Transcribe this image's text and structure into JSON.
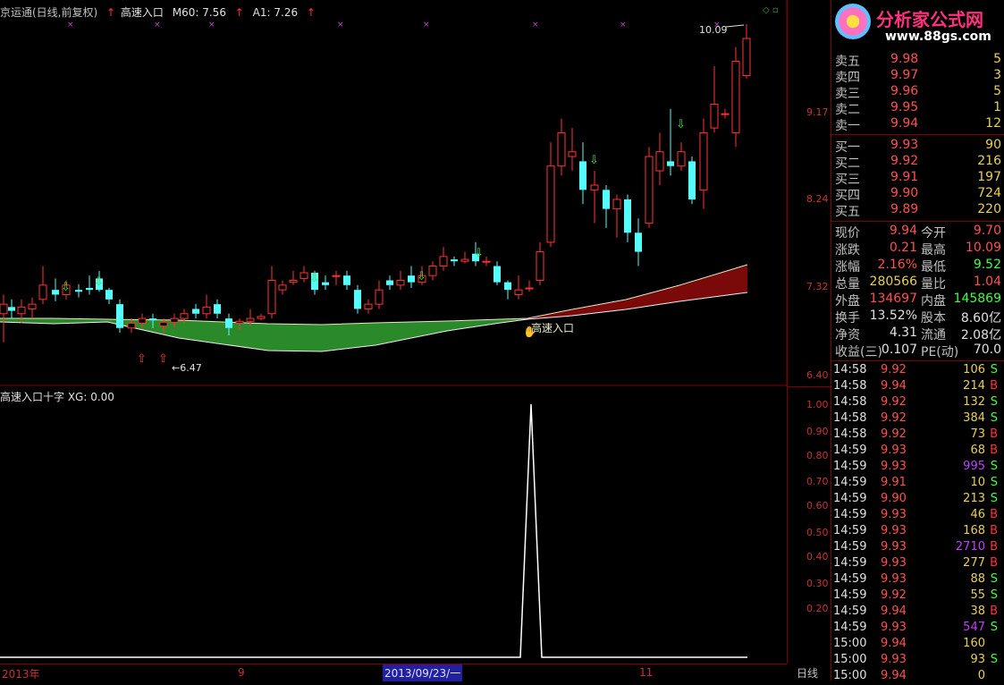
{
  "header": {
    "title": "京运通(日线,前复权)",
    "indicator": "高速入口",
    "m60_label": "M60: 7.56",
    "a1_label": "A1: 7.26"
  },
  "price_axis": [
    "9.17",
    "8.24",
    "7.32",
    "6.40"
  ],
  "price_high_note": "10.09",
  "price_low_note": "6.47",
  "signal_label": "高速入口",
  "sub_header": "高速入口十字  XG: 0.00",
  "sub_axis": [
    "1.00",
    "0.90",
    "0.80",
    "0.70",
    "0.60",
    "0.50",
    "0.40",
    "0.30",
    "0.20"
  ],
  "date_bar": {
    "start": "2013年",
    "m9": "9",
    "cursor": "2013/09/23/一",
    "m11": "11",
    "period": "日线"
  },
  "logo": {
    "brand": "分析家公式网",
    "url": "www.88gs.com"
  },
  "order_book": {
    "sells": [
      {
        "label": "卖五",
        "price": "9.98",
        "vol": "5"
      },
      {
        "label": "卖四",
        "price": "9.97",
        "vol": "3"
      },
      {
        "label": "卖三",
        "price": "9.96",
        "vol": "5"
      },
      {
        "label": "卖二",
        "price": "9.95",
        "vol": "1"
      },
      {
        "label": "卖一",
        "price": "9.94",
        "vol": "12"
      }
    ],
    "buys": [
      {
        "label": "买一",
        "price": "9.93",
        "vol": "90"
      },
      {
        "label": "买二",
        "price": "9.92",
        "vol": "216"
      },
      {
        "label": "买三",
        "price": "9.91",
        "vol": "197"
      },
      {
        "label": "买四",
        "price": "9.90",
        "vol": "724"
      },
      {
        "label": "买五",
        "price": "9.89",
        "vol": "220"
      }
    ]
  },
  "stats": [
    {
      "l1": "现价",
      "v1": "9.94",
      "l2": "今开",
      "v2": "9.70"
    },
    {
      "l1": "涨跌",
      "v1": "0.21",
      "l2": "最高",
      "v2": "10.09"
    },
    {
      "l1": "涨幅",
      "v1": "2.16%",
      "l2": "最低",
      "v2": "9.52"
    },
    {
      "l1": "总量",
      "v1": "280566",
      "l2": "量比",
      "v2": "1.04"
    },
    {
      "l1": "外盘",
      "v1": "134697",
      "l2": "内盘",
      "v2": "145869"
    },
    {
      "l1": "换手",
      "v1": "13.52%",
      "l2": "股本",
      "v2": "8.60亿"
    },
    {
      "l1": "净资",
      "v1": "4.31",
      "l2": "流通",
      "v2": "2.08亿"
    },
    {
      "l1": "收益(三)",
      "v1": "0.107",
      "l2": "PE(动)",
      "v2": "70.0"
    }
  ],
  "ticks": [
    {
      "t": "14:58",
      "p": "9.92",
      "v": "106",
      "s": "S"
    },
    {
      "t": "14:58",
      "p": "9.94",
      "v": "214",
      "s": "B"
    },
    {
      "t": "14:58",
      "p": "9.92",
      "v": "132",
      "s": "S"
    },
    {
      "t": "14:58",
      "p": "9.92",
      "v": "384",
      "s": "S"
    },
    {
      "t": "14:58",
      "p": "9.92",
      "v": "73",
      "s": "B"
    },
    {
      "t": "14:59",
      "p": "9.93",
      "v": "68",
      "s": "B"
    },
    {
      "t": "14:59",
      "p": "9.93",
      "v": "995",
      "s": "S"
    },
    {
      "t": "14:59",
      "p": "9.91",
      "v": "10",
      "s": "S"
    },
    {
      "t": "14:59",
      "p": "9.90",
      "v": "213",
      "s": "S"
    },
    {
      "t": "14:59",
      "p": "9.93",
      "v": "46",
      "s": "B"
    },
    {
      "t": "14:59",
      "p": "9.93",
      "v": "168",
      "s": "B"
    },
    {
      "t": "14:59",
      "p": "9.93",
      "v": "2710",
      "s": "B"
    },
    {
      "t": "14:59",
      "p": "9.93",
      "v": "277",
      "s": "B"
    },
    {
      "t": "14:59",
      "p": "9.93",
      "v": "88",
      "s": "S"
    },
    {
      "t": "14:59",
      "p": "9.92",
      "v": "55",
      "s": "S"
    },
    {
      "t": "14:59",
      "p": "9.94",
      "v": "38",
      "s": "B"
    },
    {
      "t": "14:59",
      "p": "9.93",
      "v": "547",
      "s": "S"
    },
    {
      "t": "15:00",
      "p": "9.94",
      "v": "160",
      "s": ""
    },
    {
      "t": "15:00",
      "p": "9.93",
      "v": "93",
      "s": "S"
    },
    {
      "t": "15:00",
      "p": "9.94",
      "v": "0",
      "s": ""
    }
  ],
  "colors": {
    "up": "#ff3232",
    "down": "#54fcfc",
    "green_fill": "#2a8a2a",
    "red_fill": "#7a0a0a",
    "axis": "#800000"
  }
}
